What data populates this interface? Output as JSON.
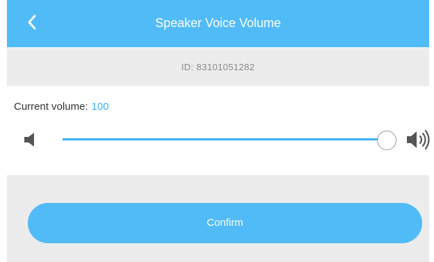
{
  "header": {
    "title": "Speaker Voice Volume",
    "back_icon": "chevron-left-icon"
  },
  "device": {
    "id_label": "ID: 83101051282"
  },
  "volume": {
    "label": "Current volume:",
    "value": "100",
    "level_percent": 100,
    "min_icon": "speaker-low-icon",
    "max_icon": "speaker-high-icon"
  },
  "actions": {
    "confirm_label": "Confirm"
  },
  "colors": {
    "accent": "#51bbf8",
    "value_text": "#3bb0f0",
    "panel_background": "#ececec"
  }
}
